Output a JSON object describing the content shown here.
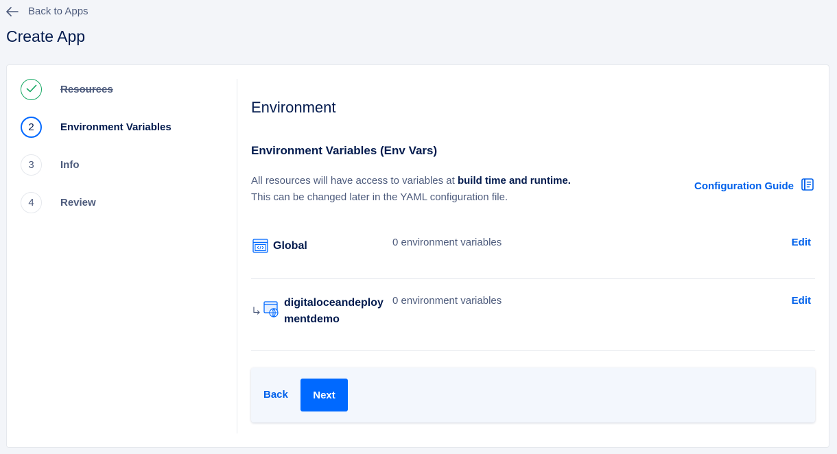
{
  "nav": {
    "back_label": "Back to Apps",
    "back_icon": "arrow-left-icon"
  },
  "page": {
    "title": "Create App"
  },
  "steps": [
    {
      "number": "",
      "label": "Resources",
      "state": "done",
      "icon": "check-icon"
    },
    {
      "number": "2",
      "label": "Environment Variables",
      "state": "active"
    },
    {
      "number": "3",
      "label": "Info",
      "state": "todo"
    },
    {
      "number": "4",
      "label": "Review",
      "state": "todo"
    }
  ],
  "main": {
    "title": "Environment",
    "subtitle": "Environment Variables (Env Vars)",
    "desc_prefix": "All resources will have access to variables at ",
    "desc_bold": "build time and runtime.",
    "desc_line2": "This can be changed later in the YAML configuration file.",
    "guide_label": "Configuration Guide",
    "guide_icon": "document-guide-icon"
  },
  "rows": [
    {
      "name": "Global",
      "count": "0 environment variables",
      "edit": "Edit",
      "icon": "code-window-icon"
    },
    {
      "name_line1": "digitaloceandeploy",
      "name_line2": "mentdemo",
      "count": "0 environment variables",
      "edit": "Edit",
      "icon": "web-service-icon",
      "arrow_icon": "sub-arrow-icon"
    }
  ],
  "footer": {
    "back_label": "Back",
    "next_label": "Next"
  },
  "colors": {
    "accent": "#0069ff",
    "link": "#0061eb",
    "success": "#15a863",
    "text": "#031b4e",
    "muted": "#4d5b7c"
  }
}
